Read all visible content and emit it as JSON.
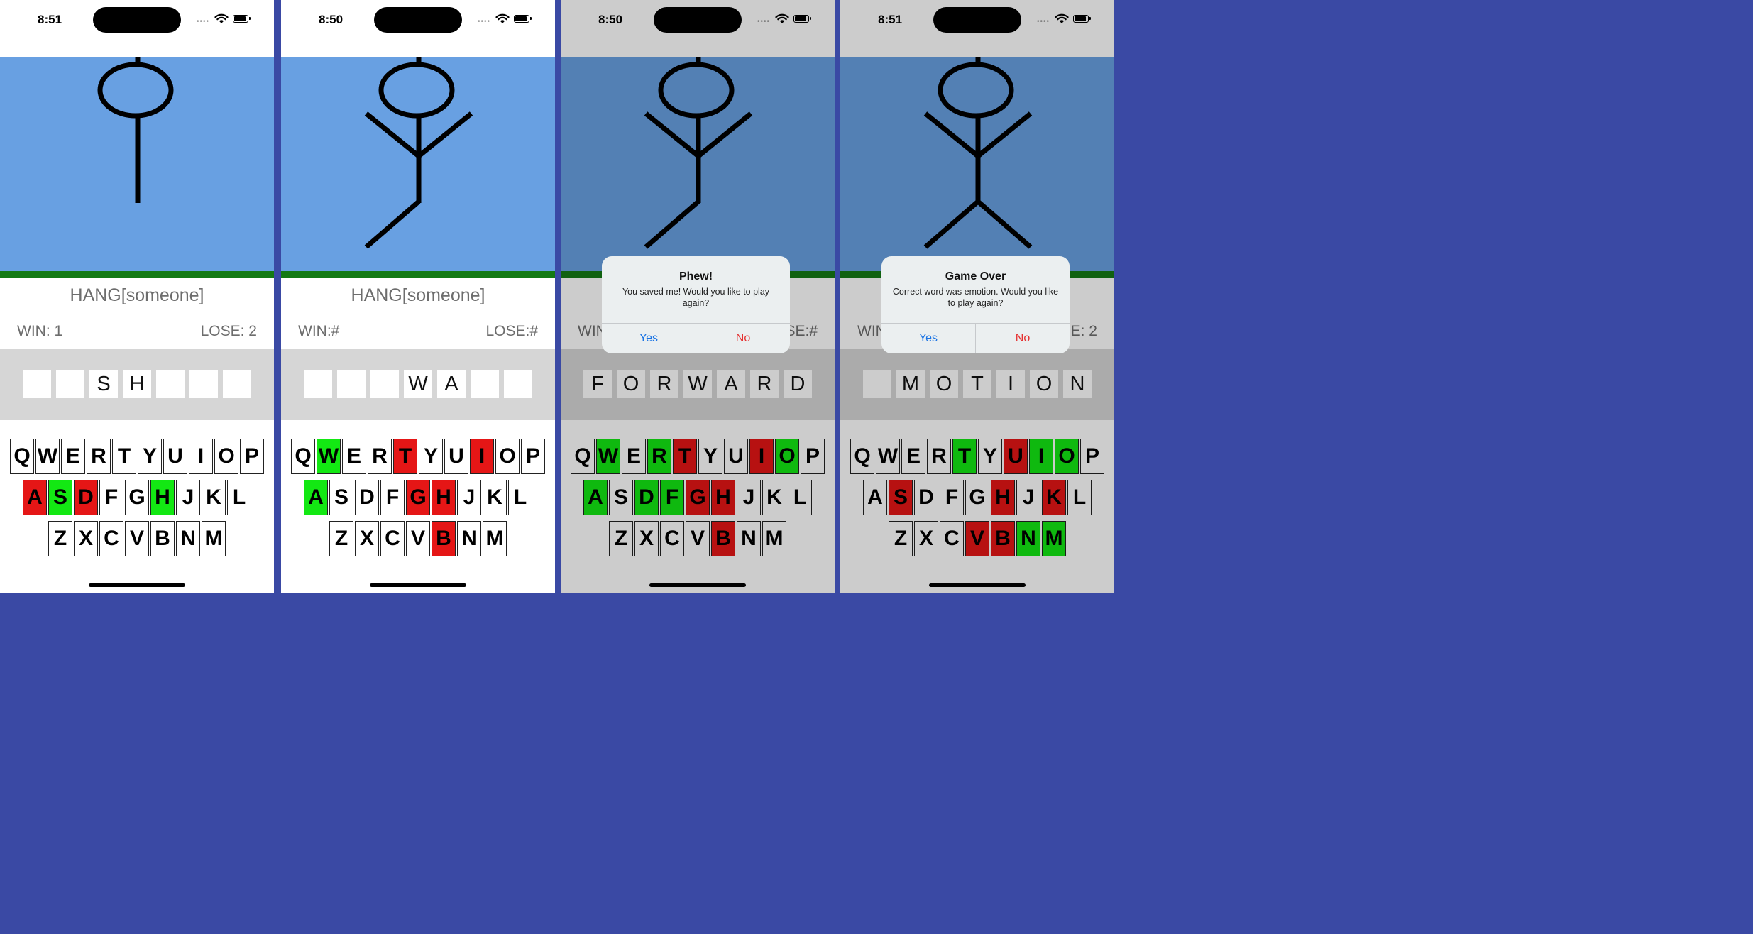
{
  "colors": {
    "sky": "#68a0e2",
    "ground": "#147a14",
    "correct_key": "#13e813",
    "wrong_key": "#e51616",
    "alert_yes": "#1b74e4",
    "alert_no": "#e53030",
    "separator": "#3a49a4"
  },
  "screens": [
    {
      "time": "8:51",
      "title": "HANG[someone]",
      "win": "WIN: 1",
      "lose": "LOSE: 2",
      "word": [
        "",
        "",
        "S",
        "H",
        "",
        "",
        ""
      ],
      "figure": [
        "head",
        "body"
      ],
      "keys": {
        "A": "red",
        "S": "green",
        "D": "red",
        "H": "green"
      },
      "alert": null
    },
    {
      "time": "8:50",
      "title": "HANG[someone]",
      "win": "WIN:#",
      "lose": "LOSE:#",
      "word": [
        "",
        "",
        "",
        "W",
        "A",
        "",
        ""
      ],
      "figure": [
        "head",
        "body",
        "left-arm",
        "right-arm",
        "left-leg"
      ],
      "keys": {
        "W": "green",
        "T": "red",
        "I": "red",
        "A": "green",
        "G": "red",
        "H": "red",
        "B": "red"
      },
      "alert": null
    },
    {
      "time": "8:50",
      "title": "HANG[someone]",
      "win": "WIN:#",
      "lose": "LOSE:#",
      "word": [
        "F",
        "O",
        "R",
        "W",
        "A",
        "R",
        "D"
      ],
      "figure": [
        "head",
        "body",
        "left-arm",
        "right-arm",
        "left-leg"
      ],
      "keys": {
        "W": "green",
        "R": "green",
        "T": "red",
        "I": "red",
        "O": "green",
        "A": "green",
        "D": "green",
        "F": "green",
        "G": "red",
        "H": "red",
        "B": "red"
      },
      "alert": {
        "title": "Phew!",
        "message": "You saved me! Would you like to play again?",
        "yes": "Yes",
        "no": "No"
      }
    },
    {
      "time": "8:51",
      "title": "HANG[someone]",
      "win": "WIN: 1",
      "lose": "LOSE: 2",
      "word": [
        "",
        "M",
        "O",
        "T",
        "I",
        "O",
        "N"
      ],
      "figure": [
        "head",
        "body",
        "left-arm",
        "right-arm",
        "left-leg",
        "right-leg"
      ],
      "keys": {
        "T": "green",
        "U": "red",
        "I": "green",
        "O": "green",
        "S": "red",
        "H": "red",
        "K": "red",
        "V": "red",
        "B": "red",
        "N": "green",
        "M": "green"
      },
      "alert": {
        "title": "Game Over",
        "message": "Correct word was emotion. Would you like to play again?",
        "yes": "Yes",
        "no": "No"
      }
    }
  ],
  "keyboard_rows": [
    [
      "Q",
      "W",
      "E",
      "R",
      "T",
      "Y",
      "U",
      "I",
      "O",
      "P"
    ],
    [
      "A",
      "S",
      "D",
      "F",
      "G",
      "H",
      "J",
      "K",
      "L"
    ],
    [
      "Z",
      "X",
      "C",
      "V",
      "B",
      "N",
      "M"
    ]
  ]
}
